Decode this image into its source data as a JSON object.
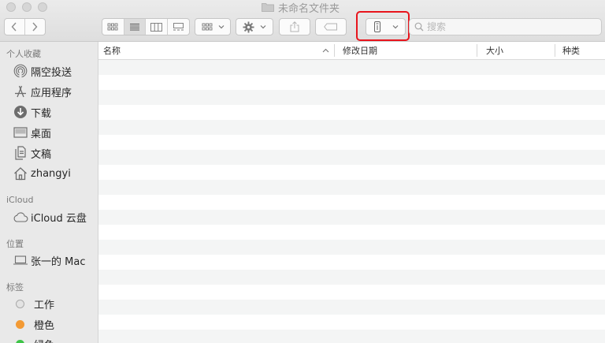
{
  "window": {
    "title": "未命名文件夹"
  },
  "search": {
    "placeholder": "搜索"
  },
  "sidebar": {
    "favorites_header": "个人收藏",
    "favorites": [
      {
        "label": "隔空投送",
        "icon": "airdrop-icon"
      },
      {
        "label": "应用程序",
        "icon": "applications-icon"
      },
      {
        "label": "下载",
        "icon": "downloads-icon"
      },
      {
        "label": "桌面",
        "icon": "desktop-icon"
      },
      {
        "label": "文稿",
        "icon": "documents-icon"
      },
      {
        "label": "zhangyi",
        "icon": "home-icon"
      }
    ],
    "icloud_header": "iCloud",
    "icloud": [
      {
        "label": "iCloud 云盘",
        "icon": "cloud-icon"
      }
    ],
    "locations_header": "位置",
    "locations": [
      {
        "label": "张一的 Mac",
        "icon": "laptop-icon"
      }
    ],
    "tags_header": "标签",
    "tags": [
      {
        "label": "工作",
        "color": "#e3e3e3"
      },
      {
        "label": "橙色",
        "color": "#f39a34"
      },
      {
        "label": "绿色",
        "color": "#3dc447"
      }
    ]
  },
  "columns": {
    "name": "名称",
    "date_modified": "修改日期",
    "size": "大小",
    "kind": "种类"
  },
  "colors": {
    "highlight": "#e8141c"
  }
}
